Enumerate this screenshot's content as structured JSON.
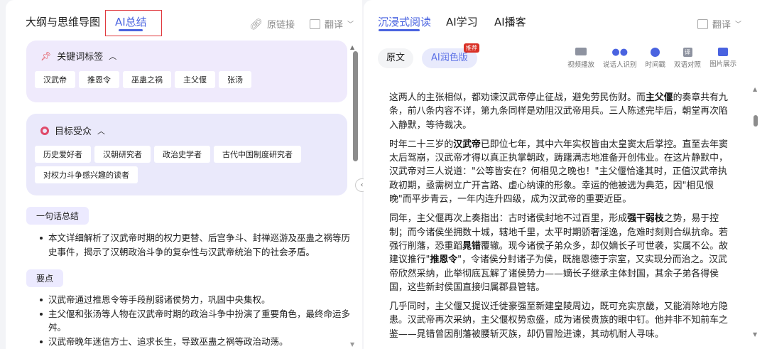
{
  "left": {
    "tabs": [
      {
        "label": "大纲与思维导图"
      },
      {
        "label": "AI总结"
      }
    ],
    "link_label": "原链接",
    "translate_label": "翻译",
    "keywords": {
      "title": "关键词标签",
      "tags": [
        "汉武帝",
        "推恩令",
        "巫蛊之祸",
        "主父偃",
        "张汤"
      ]
    },
    "audience": {
      "title": "目标受众",
      "tags": [
        "历史爱好者",
        "汉朝研究者",
        "政治史学者",
        "古代中国制度研究者",
        "对权力斗争感兴趣的读者"
      ]
    },
    "summary": {
      "title": "一句话总结",
      "items": [
        "本文详细解析了汉武帝时期的权力更替、后宫争斗、封禅巡游及巫蛊之祸等历史事件，揭示了汉朝政治斗争的复杂性与汉武帝统治下的社会矛盾。"
      ]
    },
    "points": {
      "title": "要点",
      "items": [
        "汉武帝通过推恩令等手段削弱诸侯势力，巩固中央集权。",
        "主父偃和张汤等人物在汉武帝时期的政治斗争中扮演了重要角色，最终命运多舛。",
        "汉武帝晚年迷信方士、追求长生，导致巫蛊之祸等政治动荡。"
      ]
    }
  },
  "right": {
    "tabs": [
      {
        "label": "沉浸式阅读"
      },
      {
        "label": "AI学习"
      },
      {
        "label": "AI播客"
      }
    ],
    "translate_label": "翻译",
    "versions": [
      {
        "label": "原文"
      },
      {
        "label": "AI润色版",
        "badge": "推荐"
      }
    ],
    "tools": [
      {
        "label": "视频播放",
        "icon": "video-icon",
        "color": "#8e93a0"
      },
      {
        "label": "说话人识别",
        "icon": "speakers-icon",
        "color": "#4a63e0"
      },
      {
        "label": "时间戳",
        "icon": "clock-icon",
        "color": "#4a63e0"
      },
      {
        "label": "双语对照",
        "icon": "translate-icon",
        "color": "#8e93a0"
      },
      {
        "label": "图片展示",
        "icon": "image-icon",
        "color": "#4a63e0"
      }
    ],
    "paragraphs": [
      [
        {
          "t": "这两人的主张相似，都劝谏汉武帝停止征战，避免劳民伤财。而"
        },
        {
          "t": "主父偃",
          "b": true
        },
        {
          "t": "的奏章共有九条，前八条内容不详，第九条同样是劝阻汉武帝用兵。三人陈述完毕后，朝堂再次陷入静默，等待裁决。"
        }
      ],
      [
        {
          "t": "时年二十三岁的"
        },
        {
          "t": "汉武帝",
          "b": true
        },
        {
          "t": "已即位七年，其中六年实权皆由太皇窦太后掌控。直至去年窦太后驾崩，汉武帝才得以真正执掌朝政，踌躇满志地准备开创伟业。在这片静默中，汉武帝对三人说道：\"公等皆安在？何相见之晚也！\"主父偃恰逢其时，正值汉武帝执政初期，亟需树立广开言路、虚心纳谏的形象。幸运的他被选为典范，因\"相见恨晚\"而平步青云，一年内连升四级，成为汉武帝的重要近臣。"
        }
      ],
      [
        {
          "t": "同年，主父偃再次上奏指出：古时诸侯封地不过百里，形成"
        },
        {
          "t": "强干弱枝",
          "b": true
        },
        {
          "t": "之势，易于控制；而今诸侯坐拥数十城，辖地千里，太平时期骄奢淫逸，危难时刻则合纵抗命。若强行削藩，恐重蹈"
        },
        {
          "t": "晁错",
          "b": true
        },
        {
          "t": "覆辙。现今诸侯子弟众多，却仅嫡长子可世袭，实属不公。故建议推行\""
        },
        {
          "t": "推恩令",
          "b": true
        },
        {
          "t": "\"，令诸侯分封诸子为侯，既施恩德于宗室，又实现分而治之。汉武帝欣然采纳，此举彻底瓦解了诸侯势力——嫡长子继承主体封国，其余子弟各得侯国，这些新封侯国直接归属郡县管辖。"
        }
      ],
      [
        {
          "t": "几乎同时，主父偃又提议迁徙豪强至新建皇陵周边，既可充实京畿，又能消除地方隐患。汉武帝再次采纳，主父偃权势愈盛，成为诸侯贵族的眼中钉。他并非不知前车之鉴——晁错曾因削藩被腰斩灭族，却仍冒险进谏，其动机耐人寻味。"
        }
      ]
    ]
  },
  "colors": {
    "accent": "#4a63e0",
    "card_bg": "#efedfb",
    "highlight_box": "#e0393e",
    "badge": "#d93026"
  }
}
